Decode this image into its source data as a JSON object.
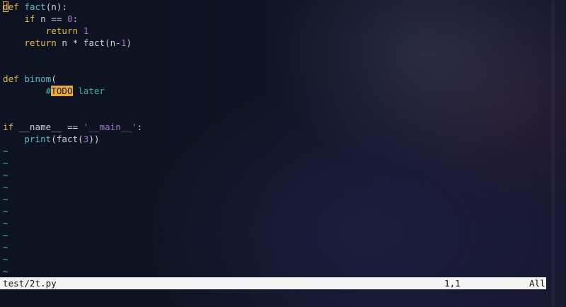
{
  "code": {
    "l1": {
      "kw": "def",
      "name": "fact",
      "rest": "(n):",
      "cursor_char": "d",
      "kw_rest": "ef"
    },
    "l2": {
      "indent": "    ",
      "kw": "if",
      "mid": " n == ",
      "num": "0",
      "end": ":"
    },
    "l3": {
      "indent": "        ",
      "kw": "return",
      "sp": " ",
      "num": "1"
    },
    "l4": {
      "indent": "    ",
      "kw": "return",
      "mid": " n * fact(n-",
      "num": "1",
      "end": ")"
    },
    "l7": {
      "kw": "def",
      "sp": " ",
      "name": "binom",
      "rest": "("
    },
    "l8": {
      "indent": "        ",
      "hash": "#",
      "todo": "TODO",
      "rest": " later"
    },
    "l11": {
      "kw": "if",
      "mid": " __name__ == ",
      "str": "'__main__'",
      "end": ":"
    },
    "l12": {
      "indent": "    ",
      "fn": "print",
      "mid": "(fact(",
      "num": "3",
      "end": "))"
    }
  },
  "tilde_char": "~",
  "status": {
    "file": "test/2t.py",
    "position": "1,1",
    "scroll": "All"
  }
}
